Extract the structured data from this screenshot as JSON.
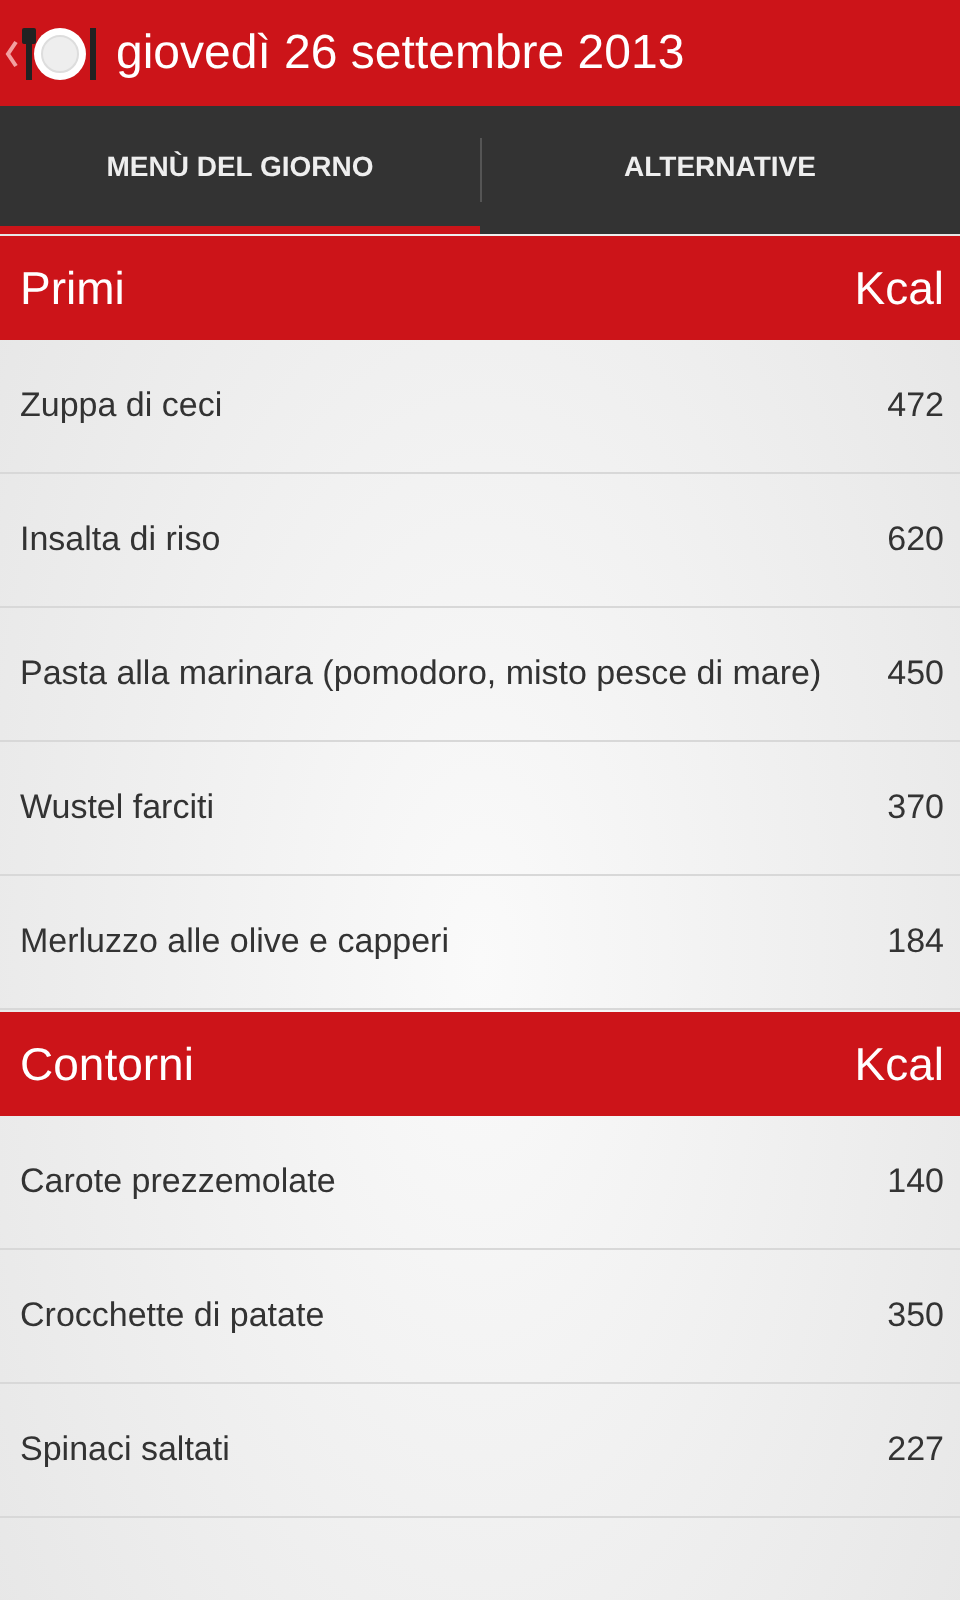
{
  "header": {
    "title": "giovedì 26 settembre 2013"
  },
  "tabs": [
    {
      "label": "MENÙ DEL GIORNO",
      "selected": true
    },
    {
      "label": "ALTERNATIVE",
      "selected": false
    }
  ],
  "sections": [
    {
      "title": "Primi",
      "unit": "Kcal",
      "items": [
        {
          "name": "Zuppa di ceci",
          "kcal": "472"
        },
        {
          "name": "Insalta di riso",
          "kcal": "620"
        },
        {
          "name": "Pasta alla marinara (pomodoro, misto pesce di mare)",
          "kcal": "450"
        },
        {
          "name": "Wustel farciti",
          "kcal": "370"
        },
        {
          "name": "Merluzzo alle olive e capperi",
          "kcal": "184"
        }
      ]
    },
    {
      "title": "Contorni",
      "unit": "Kcal",
      "items": [
        {
          "name": "Carote prezzemolate",
          "kcal": "140"
        },
        {
          "name": "Crocchette di patate",
          "kcal": "350"
        },
        {
          "name": "Spinaci saltati",
          "kcal": "227"
        }
      ]
    }
  ]
}
